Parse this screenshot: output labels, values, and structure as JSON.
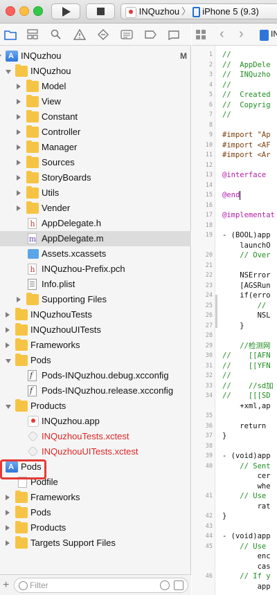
{
  "toolbar": {
    "scheme_name": "INQuzhou",
    "device_name": "iPhone 5 (9.3)"
  },
  "navigator": {
    "items": [
      {
        "label": "INQuzhou",
        "badge": "M",
        "icon": "project-icon"
      },
      {
        "label": "INQuzhou",
        "icon": "folder-icon"
      },
      {
        "label": "Model",
        "icon": "folder-icon"
      },
      {
        "label": "View",
        "icon": "folder-icon"
      },
      {
        "label": "Constant",
        "icon": "folder-icon"
      },
      {
        "label": "Controller",
        "icon": "folder-icon"
      },
      {
        "label": "Manager",
        "icon": "folder-icon"
      },
      {
        "label": "Sources",
        "icon": "folder-icon"
      },
      {
        "label": "StoryBoards",
        "icon": "folder-icon"
      },
      {
        "label": "Utils",
        "icon": "folder-icon"
      },
      {
        "label": "Vender",
        "icon": "folder-icon"
      },
      {
        "label": "AppDelegate.h",
        "icon": "header-file-icon",
        "glyph": "h"
      },
      {
        "label": "AppDelegate.m",
        "icon": "implementation-file-icon",
        "glyph": "m"
      },
      {
        "label": "Assets.xcassets",
        "icon": "assets-icon"
      },
      {
        "label": "INQuzhou-Prefix.pch",
        "icon": "header-file-icon",
        "glyph": "h"
      },
      {
        "label": "Info.plist",
        "icon": "plist-icon"
      },
      {
        "label": "Supporting Files",
        "icon": "folder-icon"
      },
      {
        "label": "INQuzhouTests",
        "icon": "folder-icon"
      },
      {
        "label": "INQuzhouUITests",
        "icon": "folder-icon"
      },
      {
        "label": "Frameworks",
        "icon": "folder-icon"
      },
      {
        "label": "Pods",
        "icon": "folder-icon"
      },
      {
        "label": "Pods-INQuzhou.debug.xcconfig",
        "icon": "xcconfig-icon"
      },
      {
        "label": "Pods-INQuzhou.release.xcconfig",
        "icon": "xcconfig-icon"
      },
      {
        "label": "Products",
        "icon": "folder-icon"
      },
      {
        "label": "INQuzhou.app",
        "icon": "app-icon"
      },
      {
        "label": "INQuzhouTests.xctest",
        "icon": "xctest-icon"
      },
      {
        "label": "INQuzhouUITests.xctest",
        "icon": "xctest-icon"
      },
      {
        "label": "Pods",
        "icon": "project-icon"
      },
      {
        "label": "Podfile",
        "icon": "file-icon"
      },
      {
        "label": "Frameworks",
        "icon": "folder-icon"
      },
      {
        "label": "Pods",
        "icon": "folder-icon"
      },
      {
        "label": "Products",
        "icon": "folder-icon"
      },
      {
        "label": "Targets Support Files",
        "icon": "folder-icon"
      }
    ],
    "filter_placeholder": "Filter"
  },
  "editor": {
    "jump_bar_text": "IN",
    "lines": [
      {
        "n": "1",
        "t": "//"
      },
      {
        "n": "2",
        "t": "//  AppDele"
      },
      {
        "n": "3",
        "t": "//  INQuzho"
      },
      {
        "n": "4",
        "t": "//"
      },
      {
        "n": "5",
        "t": "//  Created"
      },
      {
        "n": "6",
        "t": "//  Copyrig"
      },
      {
        "n": "7",
        "t": "//"
      },
      {
        "n": "8",
        "t": ""
      },
      {
        "n": "9",
        "t": "#import \"Ap"
      },
      {
        "n": "10",
        "t": "#import <AF"
      },
      {
        "n": "11",
        "t": "#import <Ar"
      },
      {
        "n": "12",
        "t": ""
      },
      {
        "n": "13",
        "t": "@interface"
      },
      {
        "n": "14",
        "t": ""
      },
      {
        "n": "15",
        "t": "@end"
      },
      {
        "n": "16",
        "t": ""
      },
      {
        "n": "17",
        "t": "@implementat"
      },
      {
        "n": "18",
        "t": ""
      },
      {
        "n": "19",
        "t": "- (BOOL)app"
      },
      {
        "n": "",
        "t": "    launchO"
      },
      {
        "n": "20",
        "t": "    // Over"
      },
      {
        "n": "21",
        "t": ""
      },
      {
        "n": "22",
        "t": "    NSError"
      },
      {
        "n": "23",
        "t": "    [AGSRun"
      },
      {
        "n": "24",
        "t": "    if(erro"
      },
      {
        "n": "25",
        "t": "        //"
      },
      {
        "n": "26",
        "t": "        NSL"
      },
      {
        "n": "27",
        "t": "    }"
      },
      {
        "n": "28",
        "t": ""
      },
      {
        "n": "29",
        "t": "    //检测网"
      },
      {
        "n": "30",
        "t": "//    [[AFN"
      },
      {
        "n": "31",
        "t": "//    [[YFN"
      },
      {
        "n": "32",
        "t": "//"
      },
      {
        "n": "33",
        "t": "//    //sd加"
      },
      {
        "n": "34",
        "t": "//    [[[SD"
      },
      {
        "n": "",
        "t": "    +xml,ap"
      },
      {
        "n": "35",
        "t": ""
      },
      {
        "n": "36",
        "t": "    return"
      },
      {
        "n": "37",
        "t": "}"
      },
      {
        "n": "38",
        "t": ""
      },
      {
        "n": "39",
        "t": "- (void)app"
      },
      {
        "n": "40",
        "t": "    // Sent"
      },
      {
        "n": "",
        "t": "        cer"
      },
      {
        "n": "",
        "t": "        whe"
      },
      {
        "n": "41",
        "t": "    // Use"
      },
      {
        "n": "",
        "t": "        rat"
      },
      {
        "n": "42",
        "t": "}"
      },
      {
        "n": "43",
        "t": ""
      },
      {
        "n": "44",
        "t": "- (void)app"
      },
      {
        "n": "45",
        "t": "    // Use"
      },
      {
        "n": "",
        "t": "        enc"
      },
      {
        "n": "",
        "t": "        cas"
      },
      {
        "n": "46",
        "t": "    // If y"
      },
      {
        "n": "",
        "t": "        app"
      }
    ]
  }
}
